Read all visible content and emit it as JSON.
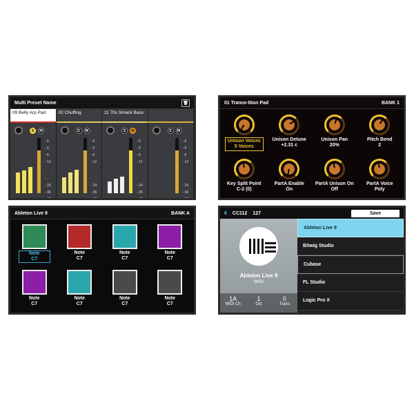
{
  "mixer": {
    "title": "Multi Preset Name",
    "trash_icon": "trash-icon",
    "tabs": [
      "09 Belly Arp Pad",
      "02 Chuffing",
      "11 70s Smack Bass",
      ""
    ],
    "solo_label": "S",
    "mute_label": "M",
    "scale": [
      "- 6",
      "- 0",
      "- 6",
      "- 12",
      "-",
      "- 24",
      "- 36",
      "- 48",
      "- 60"
    ],
    "levels": [
      {
        "fader": 0.78,
        "meter_a": 0.45,
        "meter_b": 0.5,
        "color": "#f2e15b",
        "solo": true,
        "mute": false
      },
      {
        "fader": 0.78,
        "meter_a": 0.35,
        "meter_b": 0.45,
        "color": "#f3e27a",
        "solo": false,
        "mute": false
      },
      {
        "fader": 0.78,
        "meter_a": 0.25,
        "meter_b": 0.32,
        "color": "#f0f0f0",
        "solo": false,
        "mute": true
      },
      {
        "fader": 0.78,
        "meter_a": 0,
        "meter_b": 0,
        "color": "#e6c03a",
        "solo": false,
        "mute": false
      }
    ]
  },
  "synth": {
    "title": "01 Trance-Ition Pad",
    "bank": "BANK 1",
    "params": [
      {
        "name": "Unison Voices",
        "value": "5 Voices",
        "selected": true
      },
      {
        "name": "Unison Detune",
        "value": "+2.31 c",
        "selected": false
      },
      {
        "name": "Unison Pan",
        "value": "20%",
        "selected": false
      },
      {
        "name": "Pitch Bend",
        "value": "2",
        "selected": false
      },
      {
        "name": "Key Split Point",
        "value": "C-2 (0)",
        "selected": false
      },
      {
        "name": "PartA Enable",
        "value": "On",
        "selected": false
      },
      {
        "name": "PartA Unison On",
        "value": "Off",
        "selected": false
      },
      {
        "name": "PartA Voice",
        "value": "Poly",
        "selected": false
      }
    ]
  },
  "pads": {
    "title": "Ableton Live 9",
    "bank": "BANK A",
    "items": [
      {
        "label": "Note",
        "note": "C7",
        "color": "#2e8b57",
        "selected": true
      },
      {
        "label": "Note",
        "note": "C7",
        "color": "#b52a2a",
        "selected": false
      },
      {
        "label": "Note",
        "note": "C7",
        "color": "#2aa6ad",
        "selected": false
      },
      {
        "label": "Note",
        "note": "C7",
        "color": "#8c1ea8",
        "selected": false
      },
      {
        "label": "Note",
        "note": "C7",
        "color": "#8c1ea8",
        "selected": false
      },
      {
        "label": "Note",
        "note": "C7",
        "color": "#2aa6ad",
        "selected": false
      },
      {
        "label": "Note",
        "note": "C7",
        "color": "#4a4a4a",
        "selected": false
      },
      {
        "label": "Note",
        "note": "C7",
        "color": "#4a4a4a",
        "selected": false
      }
    ]
  },
  "daw": {
    "channel": "6",
    "cc": "CC112",
    "cc_value": "127",
    "save_label": "Save",
    "name": "Ableton Live 9",
    "subtitle": "MIDI",
    "footer": [
      {
        "value": "1A",
        "label": "MIDI Ch"
      },
      {
        "value": "1",
        "label": "Oct"
      },
      {
        "value": "0",
        "label": "Trans"
      }
    ],
    "list": [
      "Ableton Live 9",
      "Bitwig Studio",
      "Cubase",
      "FL Studio",
      "Logic Pro X"
    ],
    "selected_index": 0
  }
}
